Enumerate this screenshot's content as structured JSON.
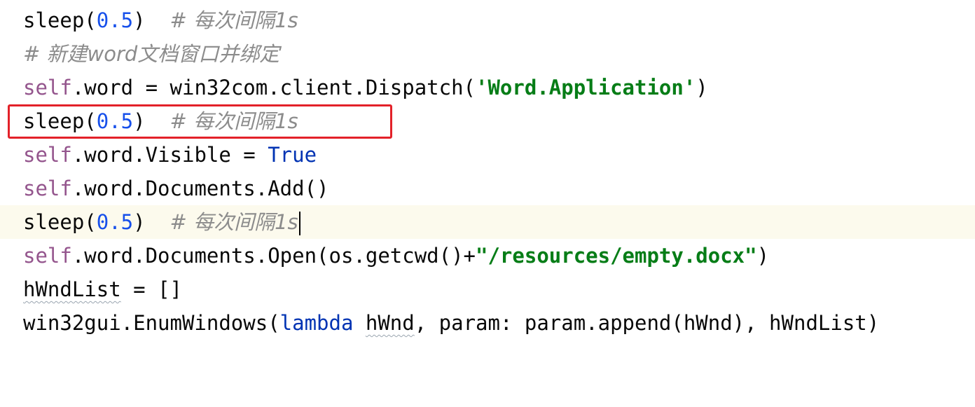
{
  "lines": [
    {
      "t1": "sleep(",
      "num": "0.5",
      "t2": ")  ",
      "cmt": "# 每次间隔1s"
    },
    {
      "cmt": "# 新建word文档窗口并绑定"
    },
    {
      "self": "self",
      "t1": ".word = win32com.client.Dispatch(",
      "str": "'Word.Application'",
      "t2": ")"
    },
    {
      "t1": "sleep(",
      "num": "0.5",
      "t2": ")  ",
      "cmt": "# 每次间隔1s"
    },
    {
      "self": "self",
      "t1": ".word.Visible = ",
      "kw": "True"
    },
    {
      "self": "self",
      "t1": ".word.Documents.Add()"
    },
    {
      "t1": "sleep(",
      "num": "0.5",
      "t2": ")  ",
      "cmt": "# 每次间隔1s"
    },
    {
      "self": "self",
      "t1": ".word.Documents.Open(os.getcwd()+",
      "str": "\"/resources/empty.docx\"",
      "t2": ")"
    },
    {
      "ident": "hWndList",
      "t1": " = []"
    },
    {
      "t1": "win32gui.EnumWindows(",
      "kw": "lambda",
      "t2": " ",
      "ident": "hWnd",
      "t3": ", param: param.append(hWnd), hWndList)"
    }
  ],
  "colors": {
    "highlight_box": "#e32129",
    "current_line_bg": "#fcfaed",
    "keyword": "#0033b3",
    "self": "#94558d",
    "number": "#1750eb",
    "string": "#067d17",
    "comment": "#8c8c8c"
  }
}
